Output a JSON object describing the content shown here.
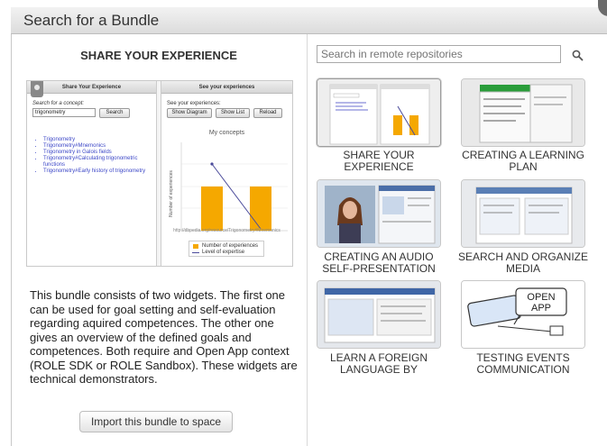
{
  "window": {
    "title": "Search for a Bundle"
  },
  "bundle": {
    "heading": "SHARE YOUR EXPERIENCE",
    "description": "This bundle consists of two widgets. The first one can be used for goal setting and self-evaluation regarding aquired competences. The other one gives an overview of the defined goals and competences. Both require and Open App context (ROLE SDK or ROLE Sandbox). These widgets are technical demonstrators.",
    "import_button": "Import this bundle to space",
    "preview": {
      "widget1": {
        "title": "Share Your Experience",
        "search_label": "Search for a concept:",
        "search_value": "trigonometry",
        "search_button": "Search",
        "results": [
          "Trigonometry",
          "Trigonometry#Mnemonics",
          "Trigonometry in Galois fields",
          "Trigonometry#Calculating trigonometric functions",
          "Trigonometry#Early history of trigonometry"
        ]
      },
      "widget2": {
        "title": "See your experiences",
        "label": "See your experiences:",
        "buttons": [
          "Show Diagram",
          "Show List",
          "Reload"
        ],
        "chart_title": "My concepts",
        "y_axis_label": "Number of experiences",
        "footer_url": "http://dbpedia.org/resource/Trigonometry#Mnemonics",
        "legend": [
          "Number of experiences",
          "Level of expertise"
        ]
      }
    }
  },
  "search": {
    "placeholder": "Search in remote repositories"
  },
  "results": [
    {
      "label": "SHARE YOUR EXPERIENCE",
      "selected": true
    },
    {
      "label": "CREATING A LEARNING PLAN",
      "selected": false
    },
    {
      "label": "CREATING AN AUDIO SELF-PRESENTATION",
      "selected": false
    },
    {
      "label": "SEARCH AND ORGANIZE MEDIA",
      "selected": false
    },
    {
      "label": "LEARN A FOREIGN LANGUAGE BY",
      "selected": false
    },
    {
      "label": "TESTING EVENTS COMMUNICATION",
      "selected": false
    }
  ],
  "open_app_logo": "OPEN APP",
  "colors": {
    "accent_bar": "#f5a800",
    "line": "#4a4a9a",
    "link": "#3c47c7"
  }
}
